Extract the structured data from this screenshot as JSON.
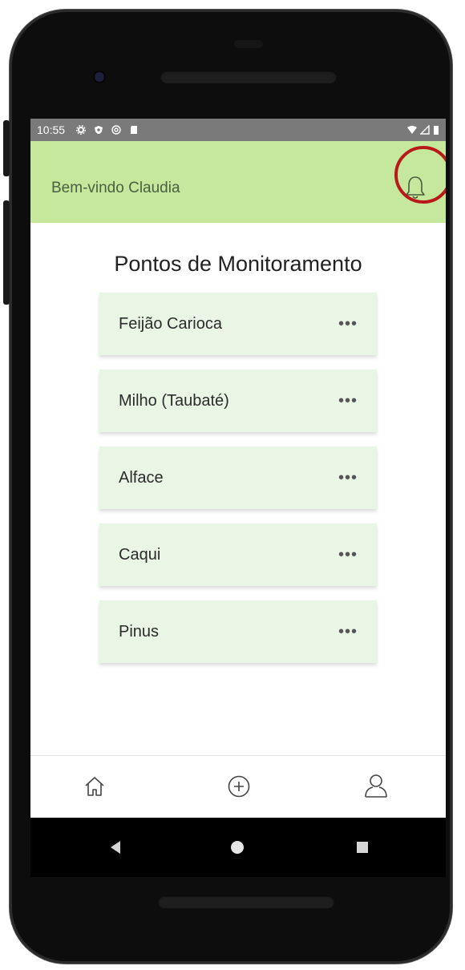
{
  "status_bar": {
    "time": "10:55",
    "left_icons": [
      "settings-icon",
      "shield-icon",
      "at-icon",
      "sd-card-icon"
    ],
    "right_icons": [
      "wifi-icon",
      "signal-icon",
      "battery-icon"
    ]
  },
  "header": {
    "welcome": "Bem-vindo Claudia",
    "bell_icon": "bell-icon",
    "background": "#c5e89c",
    "highlight_color": "#b81a1a"
  },
  "main": {
    "title": "Pontos de Monitoramento",
    "items": [
      {
        "label": "Feijão Carioca",
        "menu": "•••"
      },
      {
        "label": "Milho (Taubaté)",
        "menu": "•••"
      },
      {
        "label": "Alface",
        "menu": "•••"
      },
      {
        "label": "Caqui",
        "menu": "•••"
      },
      {
        "label": "Pinus",
        "menu": "•••"
      }
    ],
    "item_background": "#e9f6e5"
  },
  "bottom_nav": {
    "icons": [
      "home-icon",
      "add-circle-icon",
      "user-icon"
    ]
  },
  "system_nav": {
    "icons": [
      "back-icon",
      "home-circle-icon",
      "recents-icon"
    ]
  }
}
